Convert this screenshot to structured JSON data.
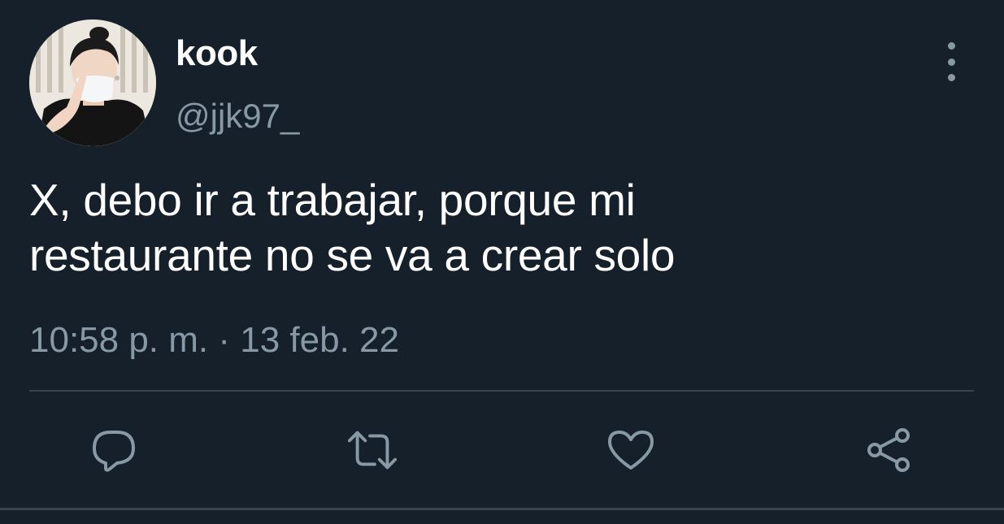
{
  "tweet": {
    "author": {
      "display_name": "kook",
      "handle": "@jjk97_"
    },
    "text_line1": "X, debo ir a trabajar, porque mi",
    "text_line2": "restaurante no se va a crear solo",
    "time": "10:58 p. m.",
    "separator": "·",
    "date": "13 feb. 22"
  },
  "actions": [
    {
      "name": "reply",
      "icon": "speech-bubble-icon"
    },
    {
      "name": "retweet",
      "icon": "retweet-arrows-icon"
    },
    {
      "name": "like",
      "icon": "heart-icon"
    },
    {
      "name": "share",
      "icon": "share-nodes-icon"
    }
  ],
  "colors": {
    "background": "#15202b",
    "primary_text": "#ffffff",
    "secondary_text": "#8899a6",
    "divider": "#38444d"
  }
}
